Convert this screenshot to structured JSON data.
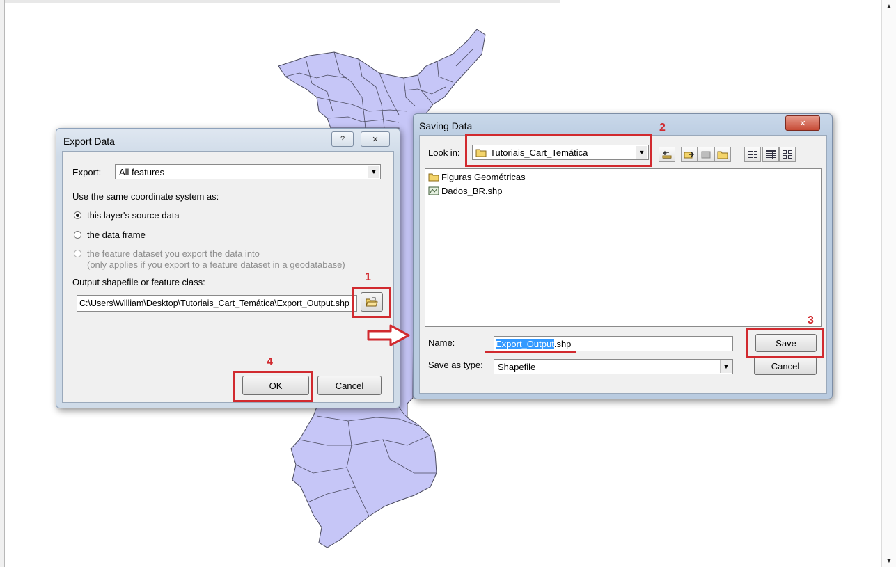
{
  "export_dialog": {
    "title": "Export Data",
    "help_label": "?",
    "close_label": "✕",
    "export_label": "Export:",
    "export_value": "All features",
    "coord_heading": "Use the same coordinate system as:",
    "radio_options": [
      {
        "label": "this layer's source data",
        "selected": true,
        "enabled": true
      },
      {
        "label": "the data frame",
        "selected": false,
        "enabled": true
      },
      {
        "label": "the feature dataset you export the data into",
        "sub_label": "(only applies if you export to a feature dataset in a geodatabase)",
        "selected": false,
        "enabled": false
      }
    ],
    "output_label": "Output shapefile or feature class:",
    "output_value": "C:\\Users\\William\\Desktop\\Tutoriais_Cart_Temática\\Export_Output.shp",
    "ok_label": "OK",
    "cancel_label": "Cancel"
  },
  "saving_dialog": {
    "title": "Saving Data",
    "close_label": "✕",
    "look_in_label": "Look in:",
    "look_in_value": "Tutoriais_Cart_Temática",
    "files": [
      {
        "name": "Figuras Geométricas",
        "icon": "folder-icon"
      },
      {
        "name": "Dados_BR.shp",
        "icon": "shapefile-icon"
      }
    ],
    "name_label": "Name:",
    "name_value_selected": "Export_Output",
    "name_value_rest": ".shp",
    "type_label": "Save as type:",
    "type_value": "Shapefile",
    "save_label": "Save",
    "cancel_label": "Cancel"
  },
  "annotations": {
    "step1": "1",
    "step2": "2",
    "step3": "3",
    "step4": "4",
    "highlight_color": "#d12a2f"
  },
  "map": {
    "fill_color": "#c6c6f7",
    "line_color": "#4a4a5e"
  }
}
